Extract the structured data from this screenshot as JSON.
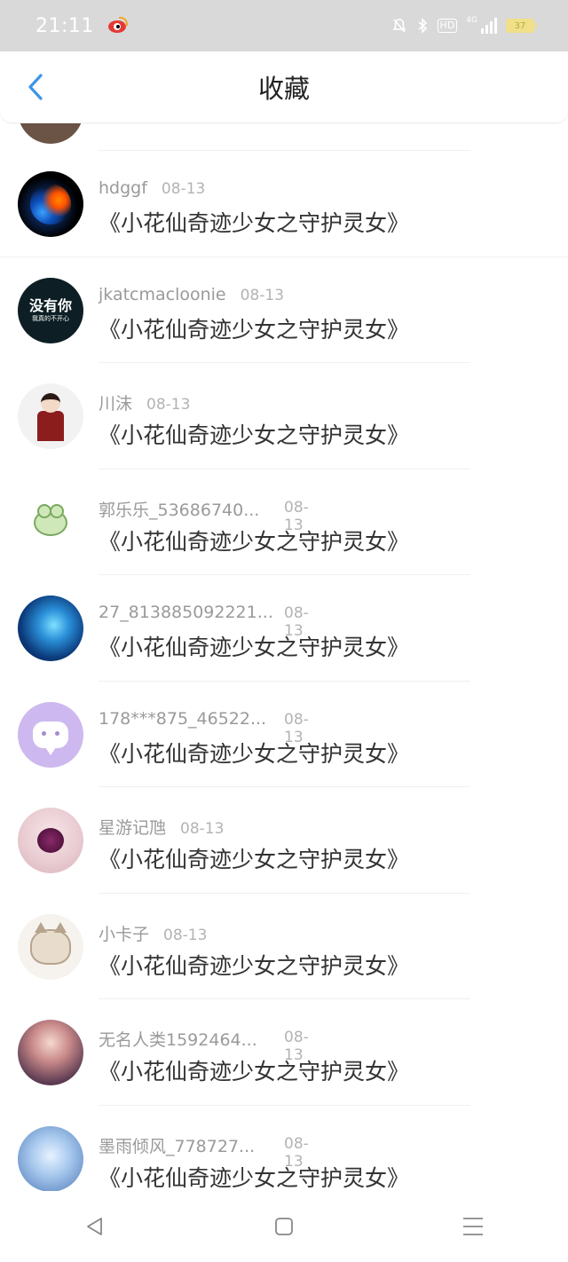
{
  "status_bar": {
    "time": "21:11",
    "network": "4G",
    "hd": "HD",
    "battery": "37"
  },
  "header": {
    "title": "收藏",
    "back_icon": "chevron-left-icon",
    "accent_color": "#3b95e8"
  },
  "items": [
    {
      "name": "",
      "date": "",
      "work": "",
      "avatar": "partial-avatar"
    },
    {
      "name": "hdggf",
      "date": "08-13",
      "work": "《小花仙奇迹少女之守护灵女》",
      "avatar": "cosmic-orb-avatar"
    },
    {
      "name": "jkatcmacloonie",
      "date": "08-13",
      "work": "《小花仙奇迹少女之守护灵女》",
      "avatar": "text-avatar",
      "avatar_text_main": "没有你",
      "avatar_text_sub": "我真的不开心"
    },
    {
      "name": "川沫",
      "date": "08-13",
      "work": "《小花仙奇迹少女之守护灵女》",
      "avatar": "anime-girl-avatar"
    },
    {
      "name": "郭乐乐_53686740...",
      "date": "08-13",
      "work": "《小花仙奇迹少女之守护灵女》",
      "avatar": "frog-avatar"
    },
    {
      "name": "27_813885092221...",
      "date": "08-13",
      "work": "《小花仙奇迹少女之守护灵女》",
      "avatar": "blue-glow-avatar"
    },
    {
      "name": "178***875_46522...",
      "date": "08-13",
      "work": "《小花仙奇迹少女之守护灵女》",
      "avatar": "chat-bubble-avatar"
    },
    {
      "name": "星游记虺",
      "date": "08-13",
      "work": "《小花仙奇迹少女之守护灵女》",
      "avatar": "rose-avatar"
    },
    {
      "name": "小卡子",
      "date": "08-13",
      "work": "《小花仙奇迹少女之守护灵女》",
      "avatar": "cat-avatar"
    },
    {
      "name": "无名人类1592464...",
      "date": "08-13",
      "work": "《小花仙奇迹少女之守护灵女》",
      "avatar": "portrait-avatar"
    },
    {
      "name": "墨雨倾风_778727...",
      "date": "08-13",
      "work": "《小花仙奇迹少女之守护灵女》",
      "avatar": "ice-princess-avatar"
    }
  ],
  "nav": {
    "back": "triangle-back-icon",
    "home": "square-home-icon",
    "menu": "hamburger-menu-icon"
  }
}
